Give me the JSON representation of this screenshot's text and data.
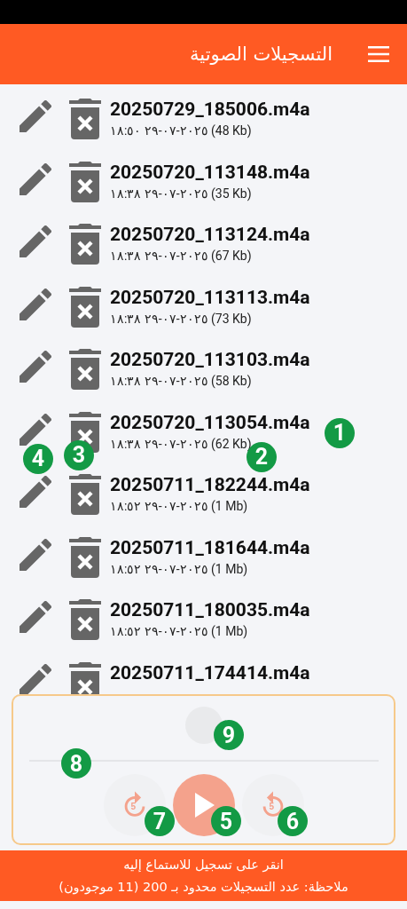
{
  "header": {
    "title": "التسجيلات الصوتية"
  },
  "recordings": [
    {
      "name": "20250729_185006.m4a",
      "meta": "١٨:٥٠ ٢٩-٠٧-٢٠٢٥ (48 Kb)"
    },
    {
      "name": "20250720_113148.m4a",
      "meta": "١٨:٣٨ ٢٩-٠٧-٢٠٢٥ (35 Kb)"
    },
    {
      "name": "20250720_113124.m4a",
      "meta": "١٨:٣٨ ٢٩-٠٧-٢٠٢٥ (67 Kb)"
    },
    {
      "name": "20250720_113113.m4a",
      "meta": "١٨:٣٨ ٢٩-٠٧-٢٠٢٥ (73 Kb)"
    },
    {
      "name": "20250720_113103.m4a",
      "meta": "١٨:٣٨ ٢٩-٠٧-٢٠٢٥ (58 Kb)"
    },
    {
      "name": "20250720_113054.m4a",
      "meta": "١٨:٣٨ ٢٩-٠٧-٢٠٢٥ (62 Kb)",
      "badges": {
        "name": "1",
        "meta": "2",
        "delete": "3",
        "edit": "4"
      }
    },
    {
      "name": "20250711_182244.m4a",
      "meta": "١٨:٥٢ ٢٩-٠٧-٢٠٢٥ (1 Mb)"
    },
    {
      "name": "20250711_181644.m4a",
      "meta": "١٨:٥٢ ٢٩-٠٧-٢٠٢٥ (1 Mb)"
    },
    {
      "name": "20250711_180035.m4a",
      "meta": "١٨:٥٢ ٢٩-٠٧-٢٠٢٥ (1 Mb)"
    },
    {
      "name": "20250711_174414.m4a"
    }
  ],
  "player": {
    "thumb_badge": "9",
    "slider": {
      "badge": "8"
    },
    "forward_badge": "7",
    "play_badge": "5",
    "rewind_badge": "6",
    "skip_forward": "5",
    "skip_back": "5"
  },
  "footer": {
    "hint": "انقر على تسجيل للاستماع إليه",
    "note": "ملاحظة: عدد التسجيلات محدود بـ 200 (11 موجودون)"
  }
}
